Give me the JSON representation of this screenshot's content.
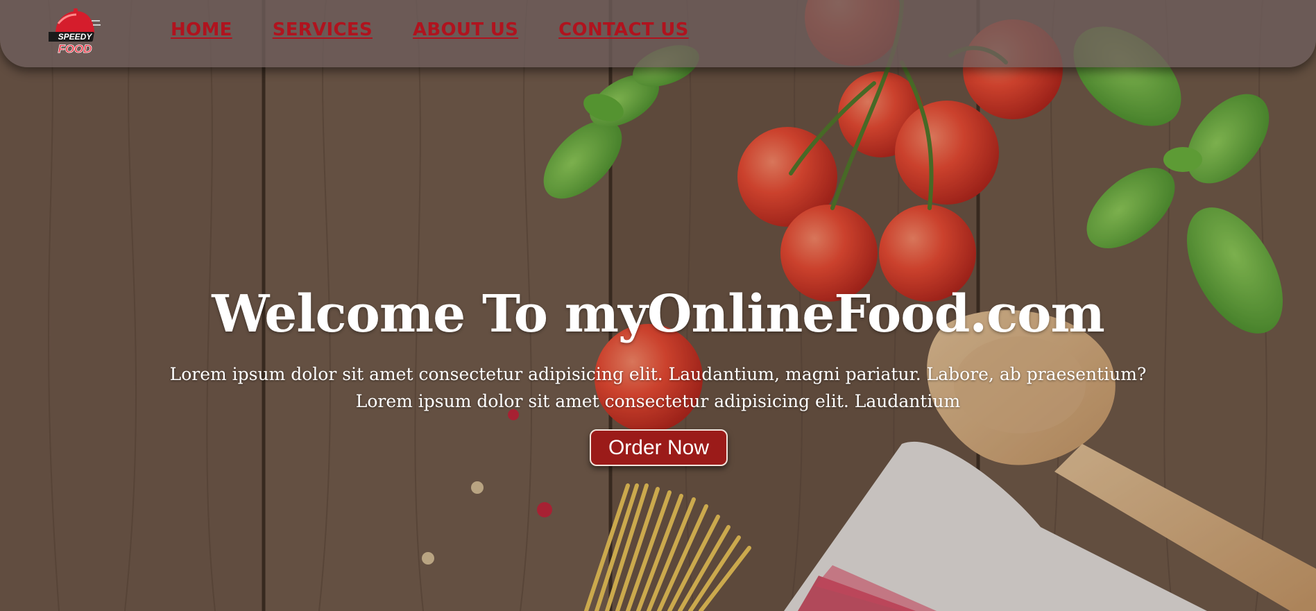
{
  "brand": {
    "logo_text_top": "SPEEDY",
    "logo_text_bottom": "FOOD",
    "accent_color": "#b0131e"
  },
  "nav": {
    "items": [
      {
        "label": "HOME"
      },
      {
        "label": "SERVICES"
      },
      {
        "label": "ABOUT US"
      },
      {
        "label": "CONTACT US"
      }
    ]
  },
  "hero": {
    "title": "Welcome To myOnlineFood.com",
    "subtitle_line1": "Lorem ipsum dolor sit amet consectetur adipisicing elit. Laudantium, magni pariatur. Labore, ab praesentium?",
    "subtitle_line2": "Lorem ipsum dolor sit amet consectetur adipisicing elit. Laudantium",
    "cta_label": "Order Now",
    "cta_color": "#9b1b19"
  }
}
